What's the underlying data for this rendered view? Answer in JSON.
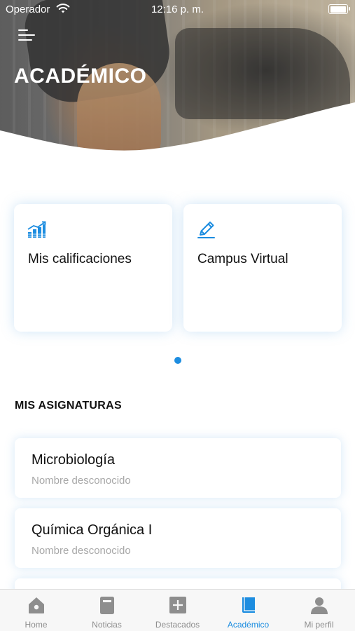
{
  "status_bar": {
    "carrier": "Operador",
    "time": "12:16 p. m."
  },
  "header": {
    "title": "ACADÉMICO"
  },
  "quick_cards": [
    {
      "label": "Mis calificaciones",
      "icon": "bar-chart-icon"
    },
    {
      "label": "Campus Virtual",
      "icon": "pencil-edit-icon"
    }
  ],
  "section": {
    "title": "MIS ASIGNATURAS"
  },
  "subjects": [
    {
      "name": "Microbiología",
      "subtitle": "Nombre desconocido"
    },
    {
      "name": "Química Orgánica I",
      "subtitle": "Nombre desconocido"
    }
  ],
  "tabbar": {
    "tabs": [
      {
        "label": "Home",
        "icon": "home-icon"
      },
      {
        "label": "Noticias",
        "icon": "news-icon"
      },
      {
        "label": "Destacados",
        "icon": "plus-square-icon"
      },
      {
        "label": "Académico",
        "icon": "book-icon"
      },
      {
        "label": "Mi perfil",
        "icon": "person-icon"
      }
    ],
    "active_index": 3
  },
  "colors": {
    "accent": "#1d8de0",
    "inactive": "#8e8e8e"
  }
}
